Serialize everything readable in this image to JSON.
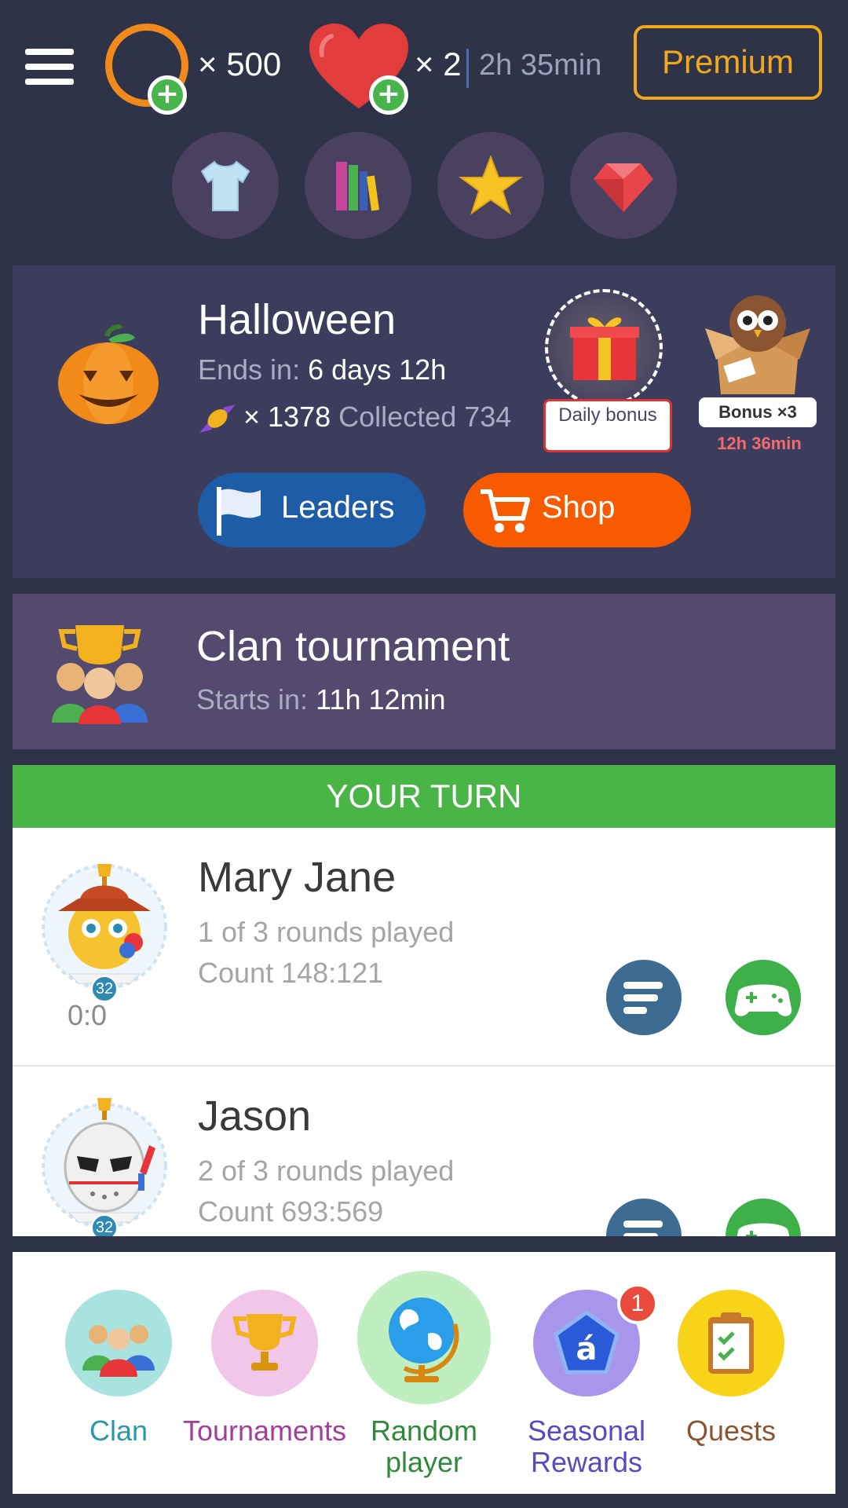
{
  "header": {
    "coins": "× 500",
    "lives": "× 2",
    "lives_timer": "2h 35min",
    "premium_label": "Premium"
  },
  "categories": [
    {
      "icon": "tshirt-icon"
    },
    {
      "icon": "books-icon"
    },
    {
      "icon": "star-icon"
    },
    {
      "icon": "gem-icon"
    }
  ],
  "event": {
    "title": "Halloween",
    "ends_label": "Ends in:",
    "ends_value": "6 days 12h",
    "candy_count": "× 1378",
    "collected": "Collected 734",
    "daily_bonus_label": "Daily bonus",
    "bonus_label": "Bonus ×3",
    "bonus_timer": "12h 36min",
    "leaders_label": "Leaders",
    "shop_label": "Shop"
  },
  "clan_tournament": {
    "title": "Clan tournament",
    "starts_label": "Starts in:",
    "starts_value": "11h 12min"
  },
  "your_turn_label": "YOUR TURN",
  "games": [
    {
      "name": "Mary Jane",
      "rounds": "1 of 3 rounds played",
      "count": "Count 148:121",
      "score": "0:0",
      "level": "32"
    },
    {
      "name": "Jason",
      "rounds": "2 of 3 rounds played",
      "count": "Count 693:569",
      "score": "",
      "level": "32"
    }
  ],
  "nav": {
    "clan": "Clan",
    "tournaments": "Tournaments",
    "random_player": "Random player",
    "seasonal_rewards": "Seasonal Rewards",
    "seasonal_badge": "1",
    "quests": "Quests"
  },
  "colors": {
    "background": "#2e3347",
    "premium": "#f2a81d",
    "your_turn": "#49b547",
    "shop": "#f85a00",
    "leaders": "#1e5ca8"
  }
}
